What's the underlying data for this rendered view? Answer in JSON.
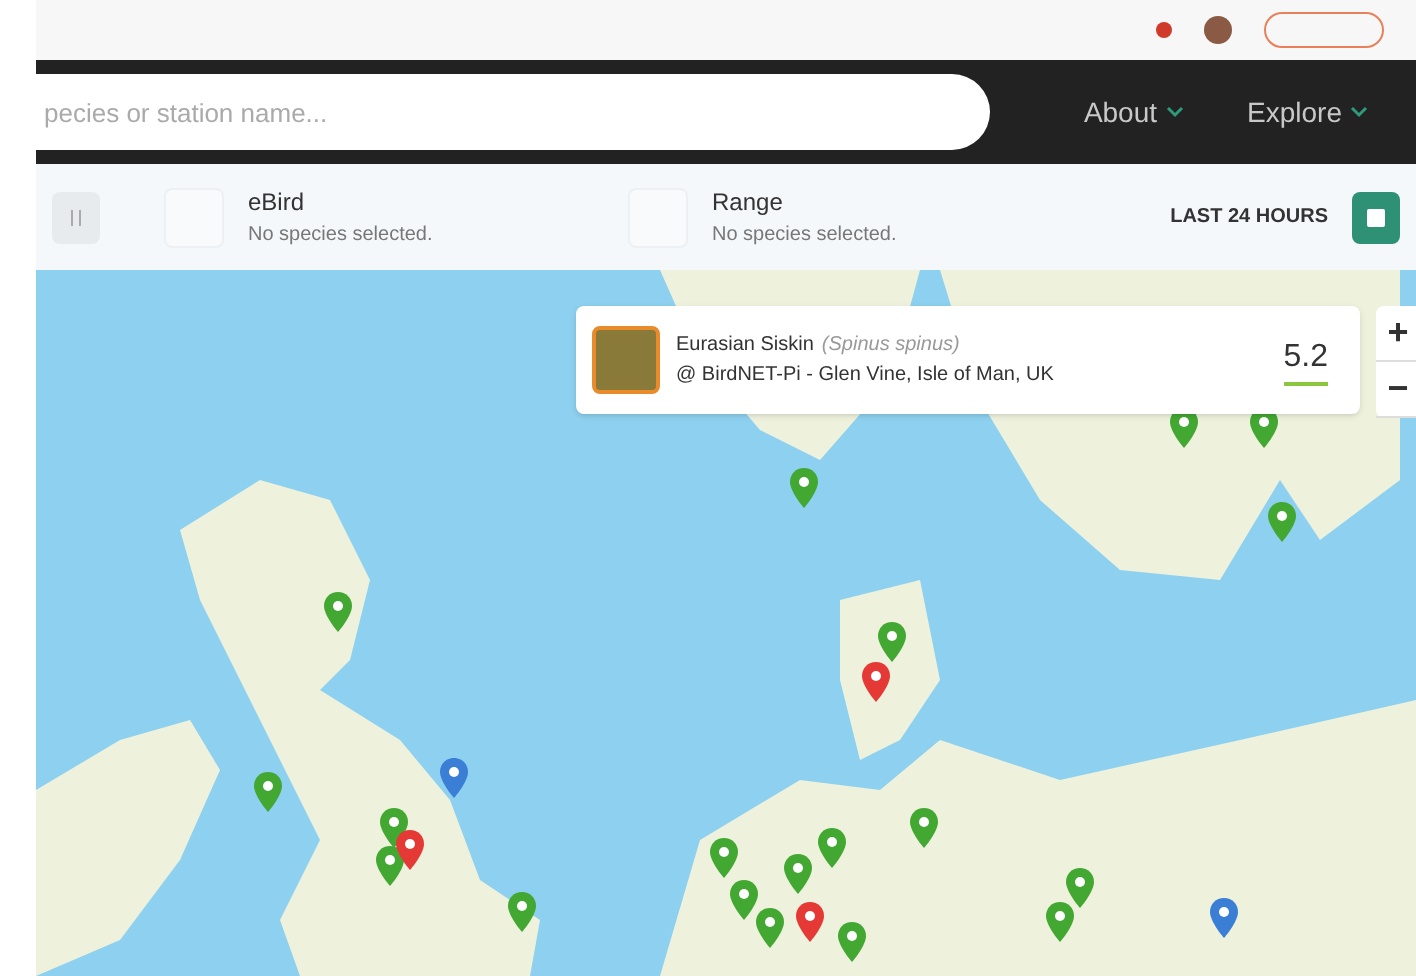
{
  "search": {
    "placeholder": "pecies or station name..."
  },
  "nav": [
    {
      "label": "About"
    },
    {
      "label": "Explore"
    }
  ],
  "filters": [
    {
      "title": "eBird",
      "status": "No species selected.",
      "checked": false
    },
    {
      "title": "Range",
      "status": "No species selected.",
      "checked": false
    }
  ],
  "time_range": "LAST 24 HOURS",
  "detection": {
    "common_name": "Eurasian Siskin",
    "scientific_name": "(Spinus spinus)",
    "station": "@ BirdNET-Pi - Glen Vine, Isle of Man, UK",
    "score": "5.2"
  },
  "zoom_controls": [
    "+",
    "−"
  ],
  "pins": [
    {
      "color": "#43a832"
    },
    {
      "color": "#43a832"
    },
    {
      "color": "#43a832"
    },
    {
      "color": "#43a832"
    },
    {
      "color": "#43a832"
    },
    {
      "color": "#43a832"
    },
    {
      "color": "#e53935"
    },
    {
      "color": "#43a832"
    },
    {
      "color": "#3a7fd5"
    },
    {
      "color": "#43a832"
    },
    {
      "color": "#43a832"
    },
    {
      "color": "#e53935"
    },
    {
      "color": "#43a832"
    },
    {
      "color": "#43a832"
    },
    {
      "color": "#43a832"
    },
    {
      "color": "#43a832"
    },
    {
      "color": "#43a832"
    },
    {
      "color": "#43a832"
    },
    {
      "color": "#43a832"
    },
    {
      "color": "#e53935"
    },
    {
      "color": "#43a832"
    },
    {
      "color": "#43a832"
    },
    {
      "color": "#3a7fd5"
    },
    {
      "color": "#43a832"
    }
  ]
}
